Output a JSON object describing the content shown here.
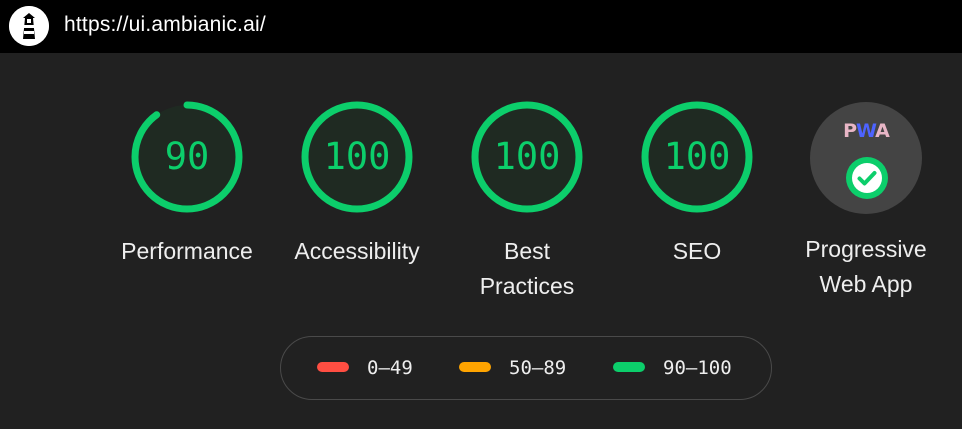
{
  "header": {
    "url": "https://ui.ambianic.ai/",
    "logo_icon": "lighthouse-icon"
  },
  "categories": [
    {
      "key": "performance",
      "score": 90,
      "score_text": "90",
      "label": "Performance",
      "color": "#0cce6b"
    },
    {
      "key": "accessibility",
      "score": 100,
      "score_text": "100",
      "label": "Accessibility",
      "color": "#0cce6b"
    },
    {
      "key": "best-practices",
      "score": 100,
      "score_text": "100",
      "label": "Best\nPractices",
      "color": "#0cce6b"
    },
    {
      "key": "seo",
      "score": 100,
      "score_text": "100",
      "label": "SEO",
      "color": "#0cce6b"
    }
  ],
  "pwa": {
    "logo_text": "PWA",
    "status_icon": "check-circle-icon",
    "label": "Progressive\nWeb App"
  },
  "legend": [
    {
      "range": "0–49",
      "color": "#ff4e42"
    },
    {
      "range": "50–89",
      "color": "#ffa400"
    },
    {
      "range": "90–100",
      "color": "#0cce6b"
    }
  ]
}
